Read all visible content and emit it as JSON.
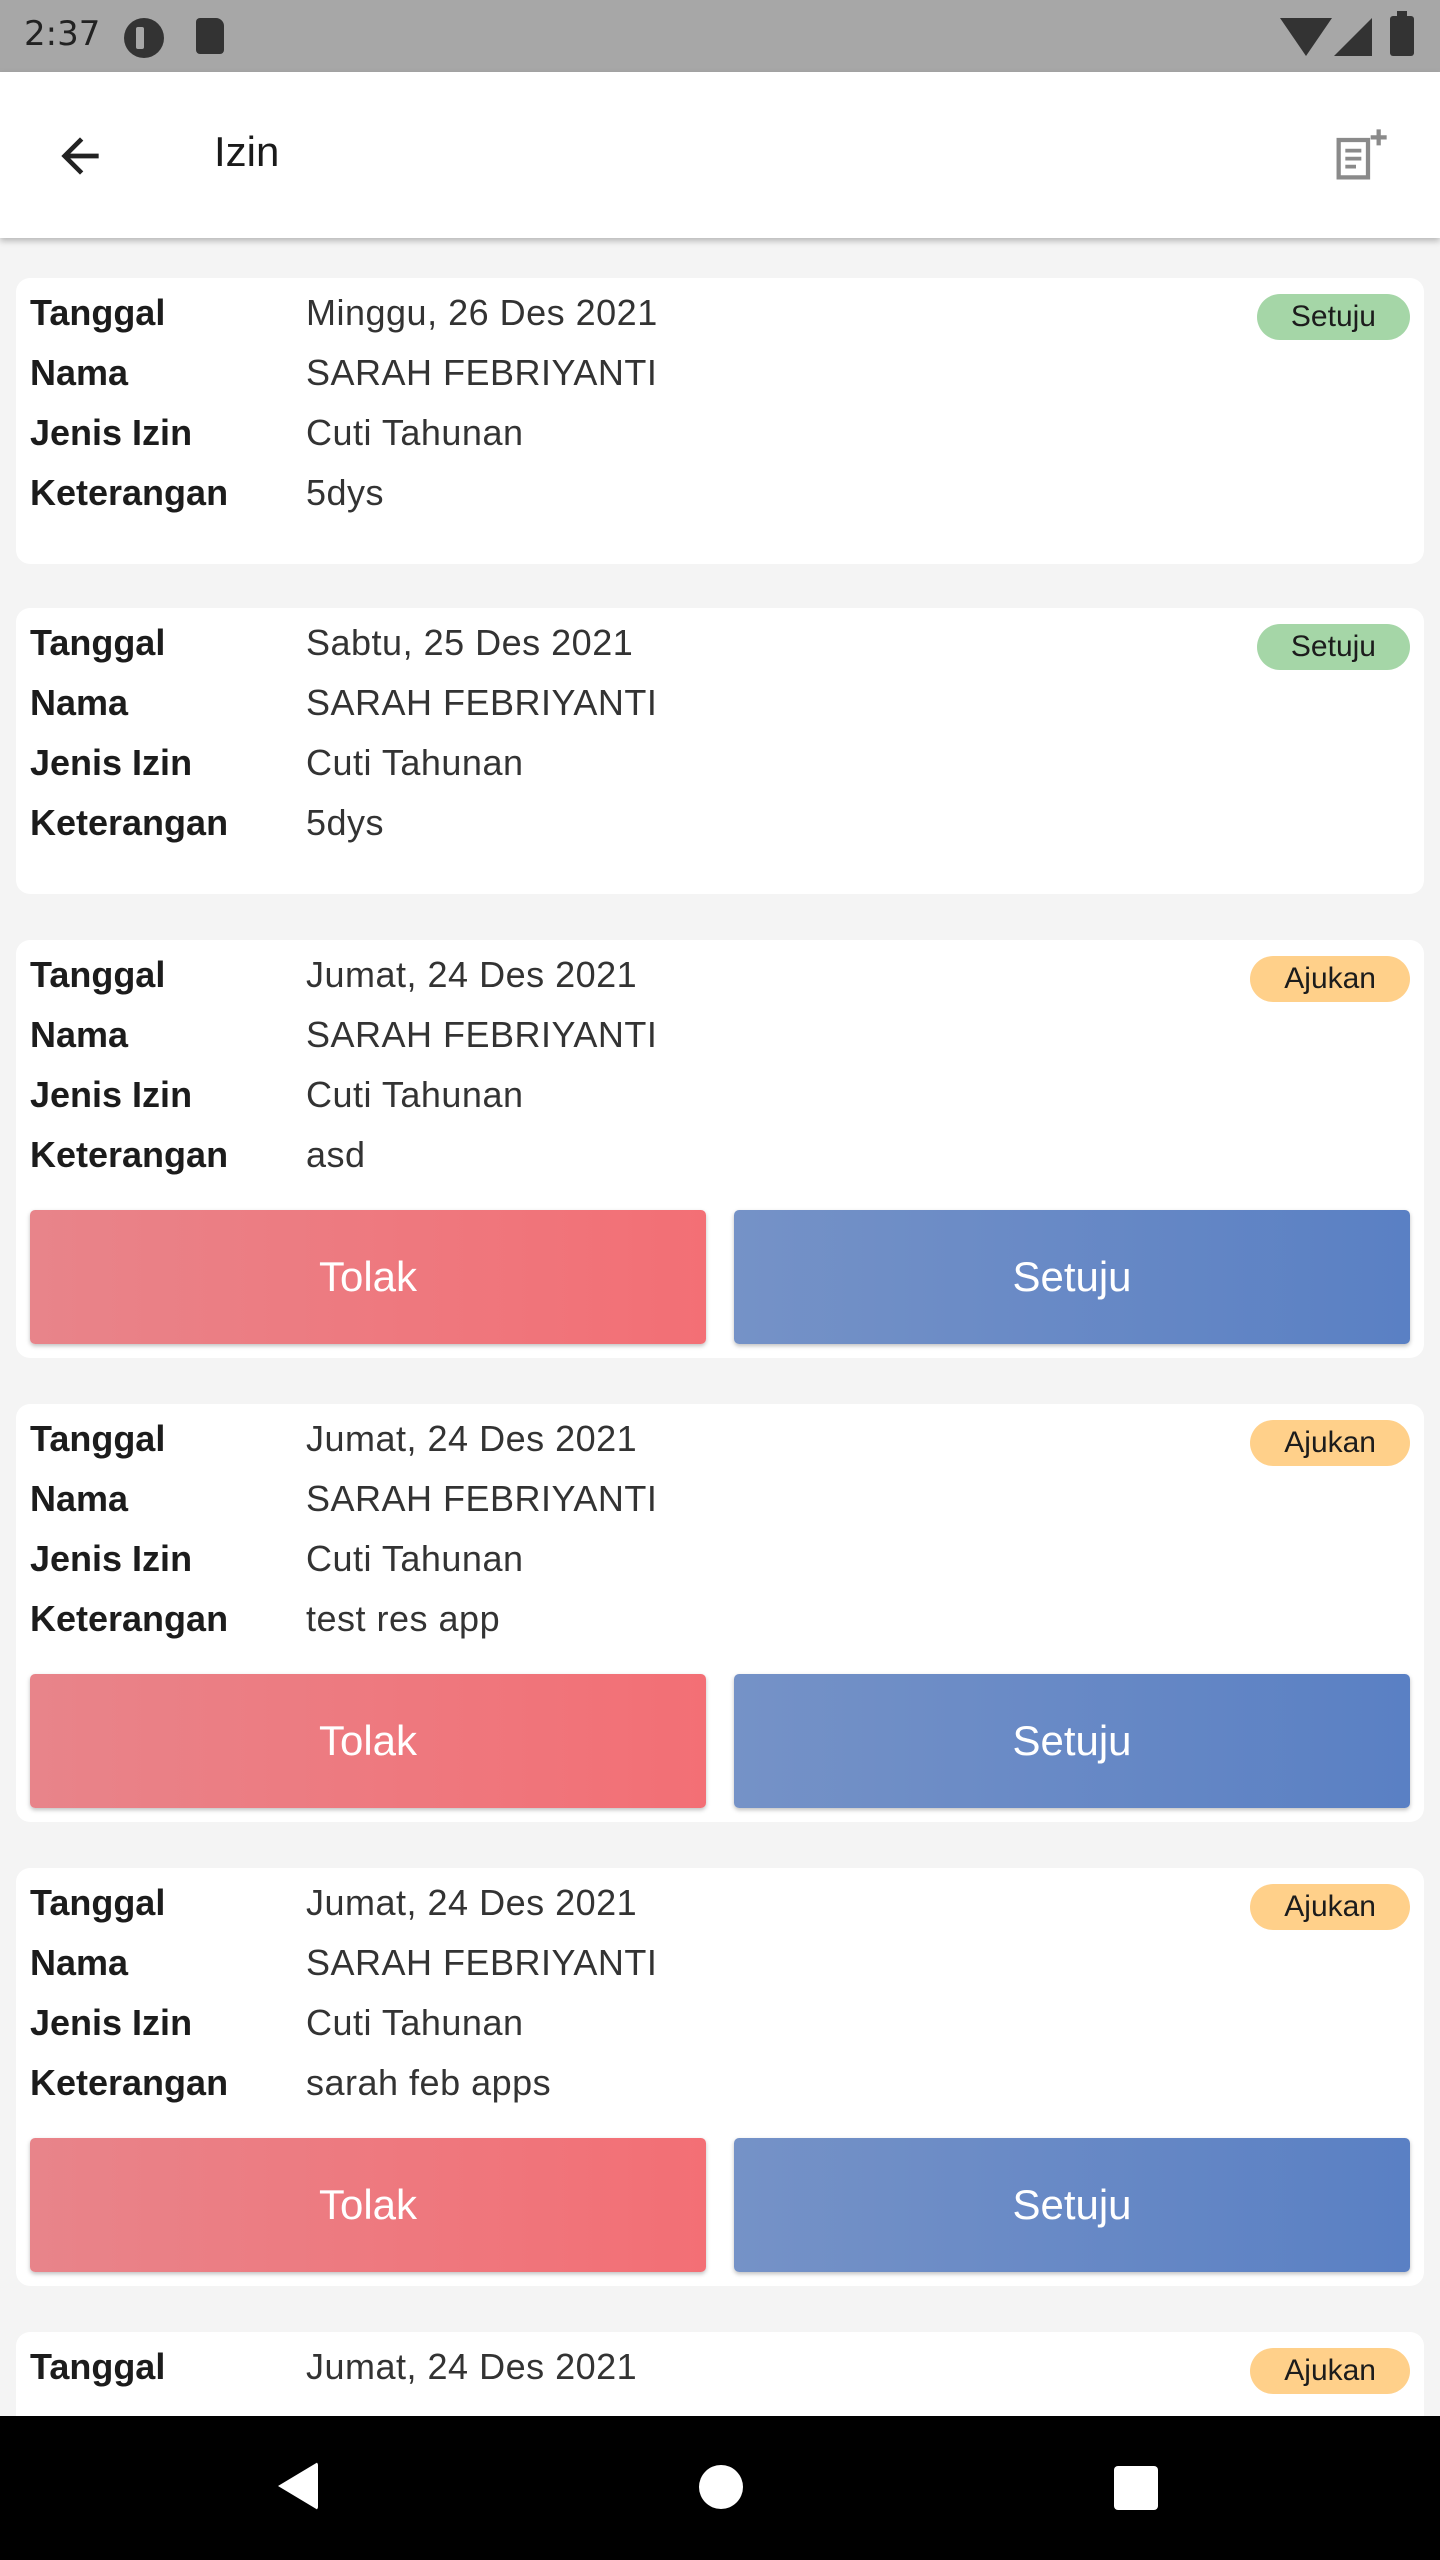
{
  "status_bar": {
    "time": "2:37"
  },
  "app_bar": {
    "title": "Izin"
  },
  "labels": {
    "tanggal": "Tanggal",
    "nama": "Nama",
    "jenis_izin": "Jenis Izin",
    "keterangan": "Keterangan",
    "tolak": "Tolak",
    "setuju": "Setuju"
  },
  "items": [
    {
      "tanggal": "Minggu, 26 Des 2021",
      "nama": "SARAH FEBRIYANTI",
      "jenis_izin": "Cuti Tahunan",
      "keterangan": "5dys",
      "status": "Setuju"
    },
    {
      "tanggal": "Sabtu, 25 Des 2021",
      "nama": "SARAH FEBRIYANTI",
      "jenis_izin": "Cuti Tahunan",
      "keterangan": "5dys",
      "status": "Setuju"
    },
    {
      "tanggal": "Jumat, 24 Des 2021",
      "nama": "SARAH FEBRIYANTI",
      "jenis_izin": "Cuti Tahunan",
      "keterangan": "asd",
      "status": "Ajukan"
    },
    {
      "tanggal": "Jumat, 24 Des 2021",
      "nama": "SARAH FEBRIYANTI",
      "jenis_izin": "Cuti Tahunan",
      "keterangan": "test res app",
      "status": "Ajukan"
    },
    {
      "tanggal": "Jumat, 24 Des 2021",
      "nama": "SARAH FEBRIYANTI",
      "jenis_izin": "Cuti Tahunan",
      "keterangan": "sarah feb apps",
      "status": "Ajukan"
    },
    {
      "tanggal": "Jumat, 24 Des 2021",
      "status": "Ajukan"
    }
  ],
  "colors": {
    "badge_setuju": "#a5d6a7",
    "badge_ajukan": "#ffd08a",
    "tolak_button": "#f36f75",
    "setuju_button": "#5a80c4"
  },
  "icons": {
    "back": "arrow-left-icon",
    "add": "note-add-icon",
    "nav_back": "triangle-back-icon",
    "nav_home": "circle-home-icon",
    "nav_recent": "square-recent-icon"
  }
}
